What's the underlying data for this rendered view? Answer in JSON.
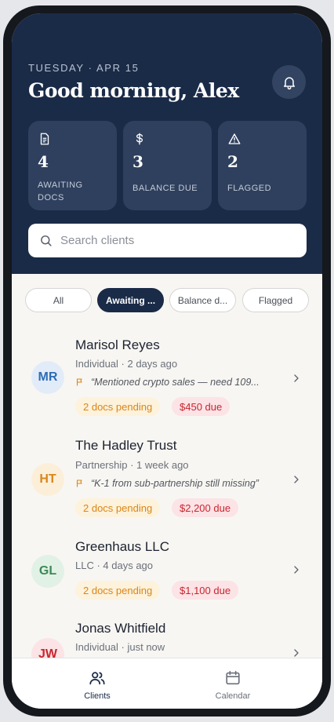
{
  "header": {
    "date": "TUESDAY · APR 15",
    "greeting": "Good morning, Alex"
  },
  "stats": [
    {
      "icon": "document-icon",
      "value": "4",
      "label_line1": "AWAITING",
      "label_line2": "DOCS"
    },
    {
      "icon": "dollar-icon",
      "value": "3",
      "label_line1": "BALANCE DUE",
      "label_line2": ""
    },
    {
      "icon": "warning-icon",
      "value": "2",
      "label_line1": "FLAGGED",
      "label_line2": ""
    }
  ],
  "search": {
    "placeholder": "Search clients"
  },
  "filters": [
    "All",
    "Awaiting ...",
    "Balance d...",
    "Flagged"
  ],
  "clients": [
    {
      "initials": "MR",
      "name": "Marisol Reyes",
      "meta": "Individual · 2 days ago",
      "note": "“Mentioned crypto sales — need 109...",
      "docs": "2 docs pending",
      "due": "$450 due"
    },
    {
      "initials": "HT",
      "name": "The Hadley Trust",
      "meta": "Partnership · 1 week ago",
      "note": "“K-1 from sub-partnership still missing”",
      "docs": "2 docs pending",
      "due": "$2,200 due"
    },
    {
      "initials": "GL",
      "name": "Greenhaus LLC",
      "meta": "LLC · 4 days ago",
      "note": "",
      "docs": "2 docs pending",
      "due": "$1,100 due"
    },
    {
      "initials": "JW",
      "name": "Jonas Whitfield",
      "meta": "Individual · just now",
      "note": "",
      "docs": "",
      "due": ""
    }
  ],
  "tabs": [
    {
      "label": "Clients",
      "icon": "users-icon"
    },
    {
      "label": "Calendar",
      "icon": "calendar-icon"
    }
  ],
  "colors": {
    "navy": "#1a2b48",
    "docs_badge_text": "#d9861a",
    "due_badge_text": "#c9262e"
  }
}
